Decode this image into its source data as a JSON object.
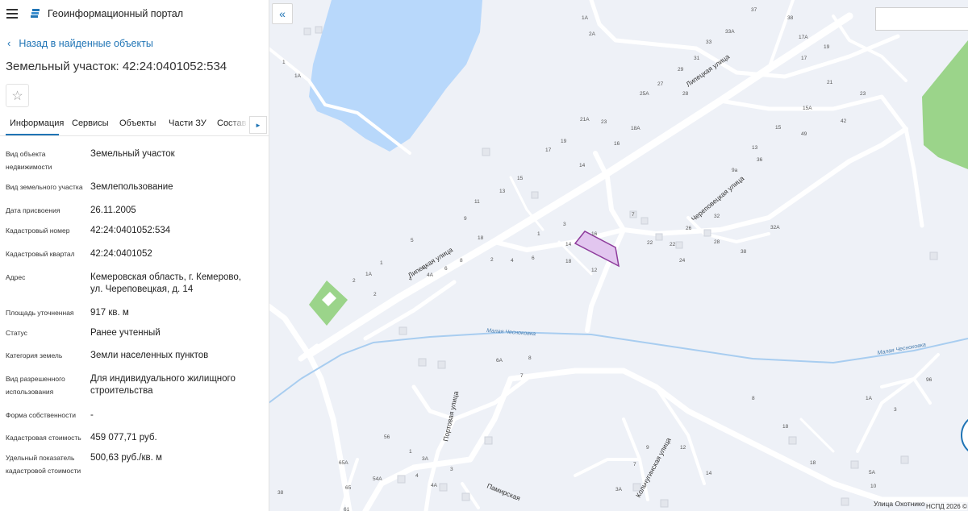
{
  "header": {
    "title": "Геоинформационный портал"
  },
  "nav": {
    "back_label": "Назад в найденные объекты"
  },
  "object": {
    "title": "Земельный участок: 42:24:0401052:534"
  },
  "tabs": [
    "Информация",
    "Сервисы",
    "Объекты",
    "Части ЗУ",
    "Состав ЕЗП"
  ],
  "fields": [
    {
      "label": "Вид объекта недвижимости",
      "value": "Земельный участок"
    },
    {
      "label": "Вид земельного участка",
      "value": "Землепользование"
    },
    {
      "label": "Дата присвоения",
      "value": "26.11.2005"
    },
    {
      "label": "Кадастровый номер",
      "value": "42:24:0401052:534"
    },
    {
      "label": "Кадастровый квартал",
      "value": "42:24:0401052"
    },
    {
      "label": "Адрес",
      "value": "Кемеровская область, г. Кемерово, ул. Череповецкая, д. 14"
    },
    {
      "label": "Площадь уточненная",
      "value": "917 кв. м"
    },
    {
      "label": "Статус",
      "value": "Ранее учтенный"
    },
    {
      "label": "Категория земель",
      "value": "Земли населенных пунктов"
    },
    {
      "label": "Вид разрешенного использования",
      "value": "Для индивидуального жилищного строительства"
    },
    {
      "label": "Форма собственности",
      "value": "-"
    },
    {
      "label": "Кадастровая стоимость",
      "value": "459 077,71 руб."
    },
    {
      "label": "Удельный показатель кадастровой стоимости",
      "value": "500,63 руб./кв. м"
    }
  ],
  "map": {
    "streets": [
      "Липецкая улица",
      "Липецкая улица",
      "Череповецкая улица",
      "Портовая улица",
      "Памирская",
      "Кольчугинская улица",
      "Улица Охотнико"
    ],
    "rivers": [
      "Малая Чесноковка",
      "Малая Чесноковка"
    ],
    "house_numbers": [
      "16",
      "14",
      "12",
      "18",
      "7",
      "6",
      "4",
      "2",
      "1",
      "3",
      "26",
      "22",
      "22",
      "24",
      "32",
      "32А",
      "28",
      "38",
      "36",
      "9а",
      "13",
      "15",
      "49",
      "15А",
      "42",
      "23",
      "21",
      "17",
      "17А",
      "38",
      "19",
      "33А",
      "33",
      "31",
      "29",
      "27",
      "25А",
      "28",
      "37",
      "21А",
      "23",
      "18А",
      "16",
      "19",
      "17",
      "13",
      "14",
      "11",
      "9",
      "15",
      "5",
      "18",
      "1",
      "2",
      "6",
      "8",
      "6",
      "4",
      "4А",
      "1А",
      "2",
      "1",
      "1А",
      "2А",
      "1А",
      "7",
      "6А",
      "8",
      "56",
      "1",
      "3А",
      "3",
      "4",
      "4А",
      "54А",
      "65А",
      "65",
      "61",
      "38",
      "9",
      "7",
      "12",
      "3А",
      "14",
      "8",
      "18",
      "18",
      "1А",
      "3",
      "96",
      "5А",
      "10"
    ],
    "footer": "НСПД 2026 ©"
  },
  "colors": {
    "accent": "#1f74b5",
    "parcel_fill": "#e2c6ef",
    "parcel_stroke": "#8e3c9c",
    "water": "#b8d8fb",
    "park": "#9bd48a",
    "map_bg": "#eef1f7"
  }
}
